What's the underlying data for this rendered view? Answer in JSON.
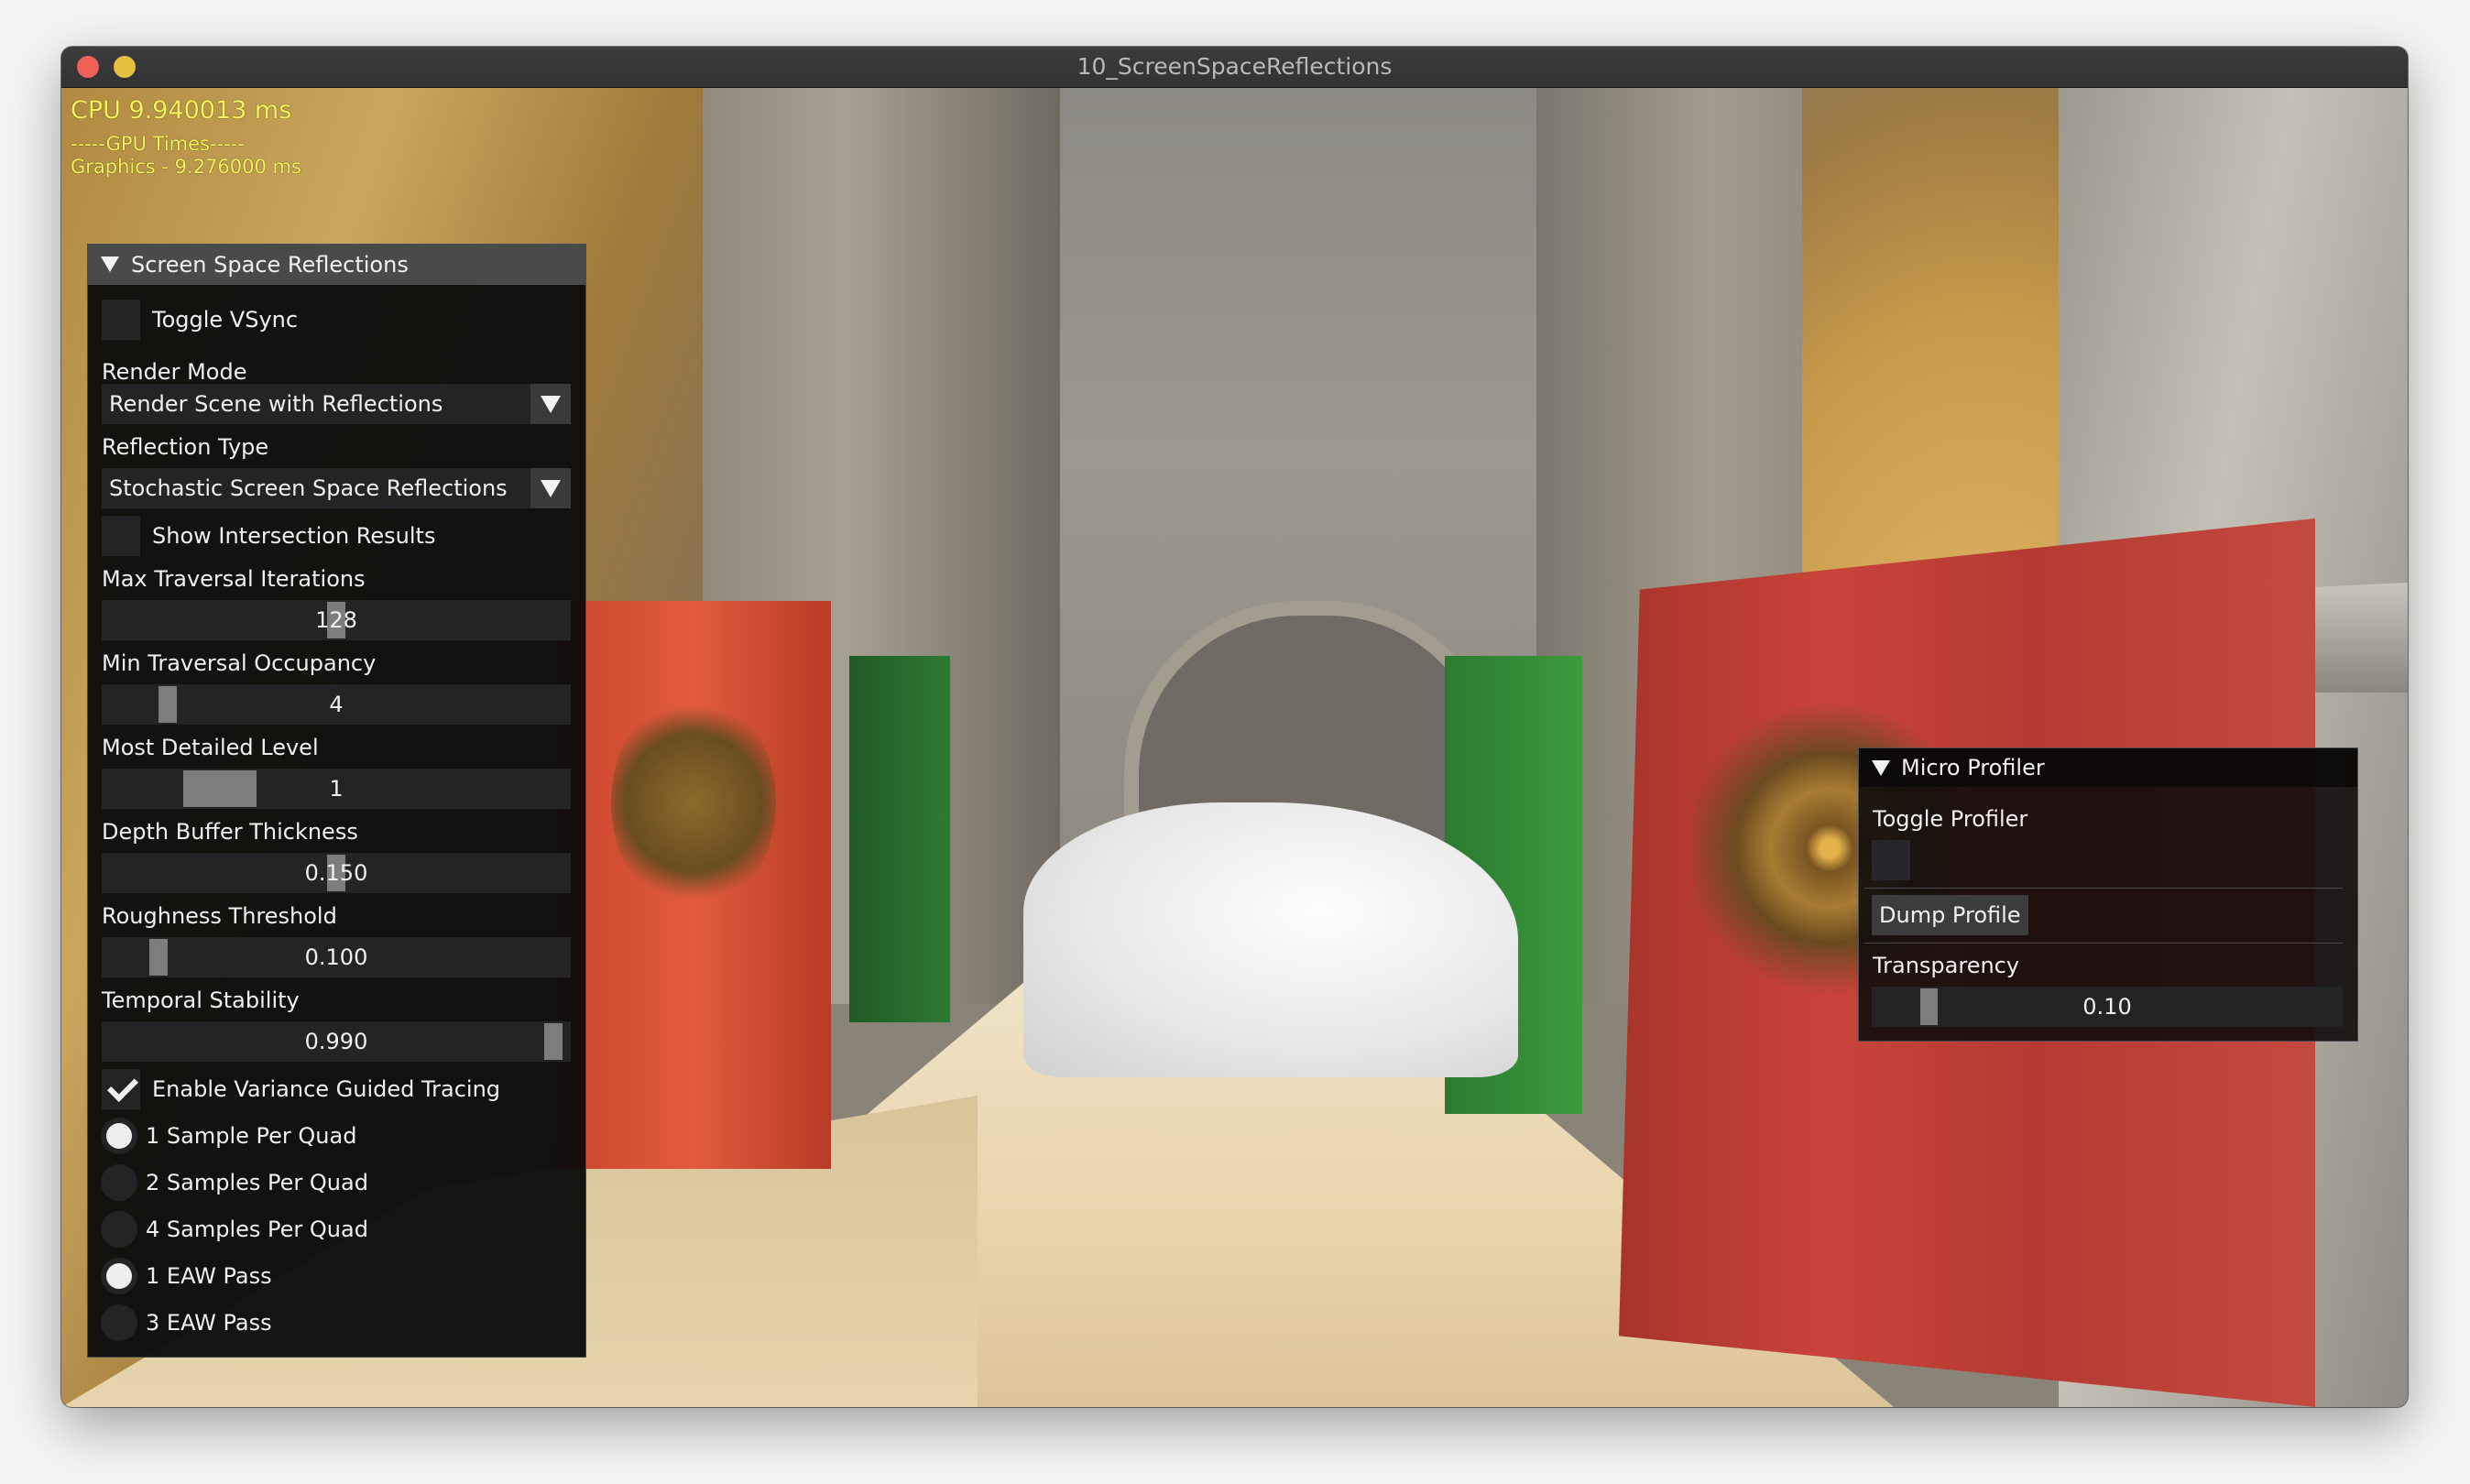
{
  "window": {
    "title": "10_ScreenSpaceReflections",
    "traffic_lights": {
      "close_color": "#ee5f57",
      "minimize_color": "#e6c140"
    }
  },
  "hud": {
    "cpu": "CPU 9.940013 ms",
    "gpu_header": "-----GPU Times-----",
    "graphics": "Graphics - 9.276000 ms",
    "color": "#f7f35a"
  },
  "ssr_panel": {
    "title": "Screen Space Reflections",
    "toggle_vsync": {
      "label": "Toggle VSync",
      "checked": false
    },
    "render_mode": {
      "label": "Render Mode",
      "selected": "Render Scene with Reflections"
    },
    "reflection_type": {
      "label": "Reflection Type",
      "selected": "Stochastic Screen Space Reflections"
    },
    "show_intersection": {
      "label": "Show Intersection Results",
      "checked": false
    },
    "sliders": [
      {
        "label": "Max Traversal Iterations",
        "value": "128",
        "fraction": 0.5
      },
      {
        "label": "Min Traversal Occupancy",
        "value": "4",
        "fraction": 0.12
      },
      {
        "label": "Most Detailed Level",
        "value": "1",
        "fraction": 0.2
      },
      {
        "label": "Depth Buffer Thickness",
        "value": "0.150",
        "fraction": 0.5
      },
      {
        "label": "Roughness Threshold",
        "value": "0.100",
        "fraction": 0.1
      },
      {
        "label": "Temporal Stability",
        "value": "0.990",
        "fraction": 0.99
      }
    ],
    "variance_guided": {
      "label": "Enable Variance Guided Tracing",
      "checked": true
    },
    "radios": [
      {
        "label": "1 Sample  Per Quad",
        "selected": true
      },
      {
        "label": "2 Samples Per Quad",
        "selected": false
      },
      {
        "label": "4 Samples Per Quad",
        "selected": false
      },
      {
        "label": "1 EAW Pass",
        "selected": true
      },
      {
        "label": "3 EAW Pass",
        "selected": false
      }
    ]
  },
  "profiler_panel": {
    "title": "Micro Profiler",
    "toggle_profiler": {
      "label": "Toggle Profiler",
      "checked": false
    },
    "dump_button": "Dump Profile",
    "transparency": {
      "label": "Transparency",
      "value": "0.10",
      "fraction": 0.1
    }
  }
}
